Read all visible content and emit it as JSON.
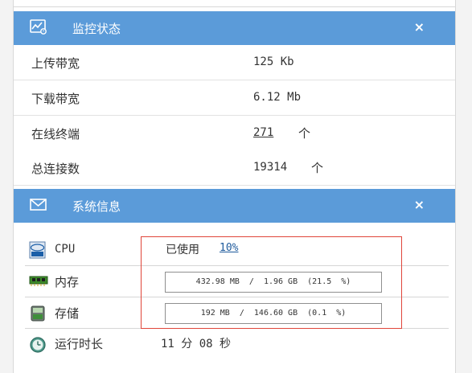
{
  "monitor": {
    "title": "监控状态",
    "close": "×",
    "rows": [
      {
        "label": "上传带宽",
        "value": "125 Kb"
      },
      {
        "label": "下载带宽",
        "value": "6.12 Mb"
      },
      {
        "label": "在线终端",
        "value": "271",
        "unit": "个"
      },
      {
        "label": "总连接数",
        "value": "19314",
        "unit": "个"
      }
    ]
  },
  "sysinfo": {
    "title": "系统信息",
    "close": "×",
    "cpu": {
      "label": "CPU",
      "used_label": "已使用",
      "value": "10%"
    },
    "memory": {
      "label": "内存",
      "value": "432.98 MB  /  1.96 GB  (21.5  %)",
      "percent": 21.5
    },
    "storage": {
      "label": "存储",
      "value": "192 MB  /  146.60 GB  (0.1  %)",
      "percent": 0.1
    },
    "uptime": {
      "label": "运行时长",
      "value": "11 分 08 秒"
    }
  },
  "colors": {
    "header": "#5b9bd9",
    "highlight_box": "#e0453a",
    "link": "#1e5a9c"
  },
  "icons": {
    "monitor": "chart-monitor-icon",
    "sysinfo": "envelope-icon",
    "cpu": "intel-cpu-icon",
    "memory": "ram-icon",
    "storage": "disk-icon",
    "uptime": "clock-icon"
  }
}
